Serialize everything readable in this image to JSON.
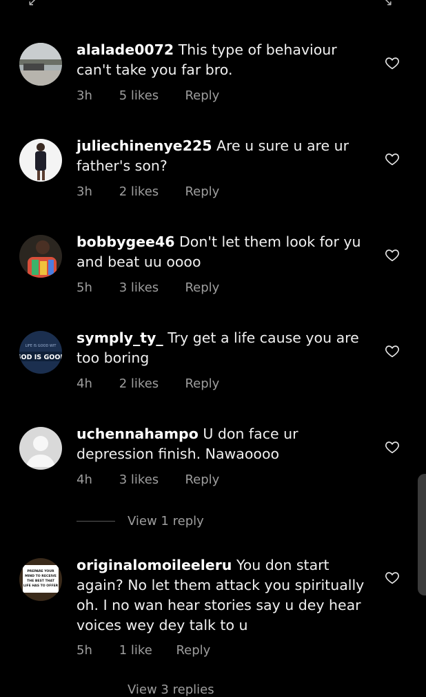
{
  "comments": [
    {
      "username": "alalade0072",
      "text": "This type of behaviour can't take you far bro.",
      "time": "3h",
      "likes": "5 likes",
      "reply": "Reply"
    },
    {
      "username": "juliechinenye225",
      "text": "Are u sure u are ur father's son?",
      "time": "3h",
      "likes": "2 likes",
      "reply": "Reply"
    },
    {
      "username": "bobbygee46",
      "text": "Don't let them look for yu and beat uu oooo",
      "time": "5h",
      "likes": "3 likes",
      "reply": "Reply"
    },
    {
      "username": "symply_ty_",
      "text": "Try get a life cause you are too boring",
      "time": "4h",
      "likes": "2 likes",
      "reply": "Reply",
      "avatar_text_top": "LIFE IS GOOD WIT",
      "avatar_text_main": "GOD IS GOOD"
    },
    {
      "username": "uchennahampo",
      "text": "U don face ur depression finish. Nawaoooo",
      "time": "4h",
      "likes": "3 likes",
      "reply": "Reply"
    },
    {
      "username": "originalomoileeleru",
      "text": "You don start again? No let them attack you spiritually oh. I no wan hear stories say u dey hear voices wey dey talk to u",
      "time": "5h",
      "likes": "1 like",
      "reply": "Reply",
      "avatar_text_lines": [
        "PREPARE YOUR",
        "MIND TO RECEIVE",
        "THE BEST THAT",
        "LIFE HAS TO OFFER"
      ]
    }
  ],
  "view_replies": {
    "first": "View 1 reply",
    "second": "View 3 replies"
  },
  "icons": {
    "like": "heart-icon",
    "default_avatar": "person-icon"
  },
  "colors": {
    "background": "#000000",
    "text": "#f0f0f0",
    "meta": "#9e9e9e"
  }
}
